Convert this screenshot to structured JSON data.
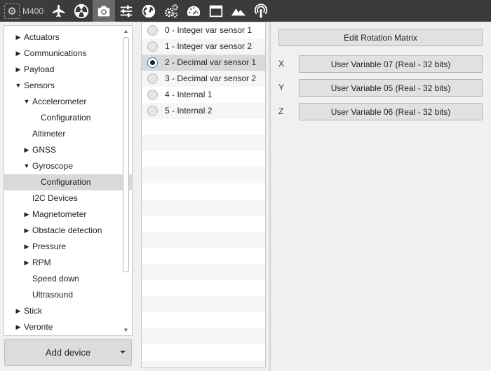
{
  "toolbar": {
    "device_label": "M400",
    "buttons": [
      {
        "icon": "airplane-icon",
        "active": false
      },
      {
        "icon": "radiation-icon",
        "active": false
      },
      {
        "icon": "camera-icon",
        "active": true
      },
      {
        "icon": "sliders-icon",
        "active": false
      },
      {
        "icon": "globe-icon",
        "active": false
      },
      {
        "icon": "gears-icon",
        "active": false
      },
      {
        "icon": "gauge-icon",
        "active": false
      },
      {
        "icon": "window-icon",
        "active": false
      },
      {
        "icon": "mountains-icon",
        "active": false
      },
      {
        "icon": "antenna-icon",
        "active": false
      }
    ]
  },
  "tree": [
    {
      "label": "Actuators",
      "level": 0,
      "arrow": "collapsed"
    },
    {
      "label": "Communications",
      "level": 0,
      "arrow": "collapsed"
    },
    {
      "label": "Payload",
      "level": 0,
      "arrow": "collapsed"
    },
    {
      "label": "Sensors",
      "level": 0,
      "arrow": "expanded"
    },
    {
      "label": "Accelerometer",
      "level": 1,
      "arrow": "expanded"
    },
    {
      "label": "Configuration",
      "level": 2,
      "arrow": "none"
    },
    {
      "label": "Altimeter",
      "level": 1,
      "arrow": "none"
    },
    {
      "label": "GNSS",
      "level": 1,
      "arrow": "collapsed"
    },
    {
      "label": "Gyroscope",
      "level": 1,
      "arrow": "expanded"
    },
    {
      "label": "Configuration",
      "level": 2,
      "arrow": "none",
      "selected": true
    },
    {
      "label": "I2C Devices",
      "level": 1,
      "arrow": "none"
    },
    {
      "label": "Magnetometer",
      "level": 1,
      "arrow": "collapsed"
    },
    {
      "label": "Obstacle detection",
      "level": 1,
      "arrow": "collapsed"
    },
    {
      "label": "Pressure",
      "level": 1,
      "arrow": "collapsed"
    },
    {
      "label": "RPM",
      "level": 1,
      "arrow": "collapsed"
    },
    {
      "label": "Speed down",
      "level": 1,
      "arrow": "none"
    },
    {
      "label": "Ultrasound",
      "level": 1,
      "arrow": "none"
    },
    {
      "label": "Stick",
      "level": 0,
      "arrow": "collapsed"
    },
    {
      "label": "Veronte",
      "level": 0,
      "arrow": "collapsed"
    }
  ],
  "add_device_label": "Add device",
  "sensors": [
    {
      "label": "0 - Integer var sensor 1",
      "checked": false
    },
    {
      "label": "1 - Integer var sensor 2",
      "checked": false
    },
    {
      "label": "2 - Decimal var sensor 1",
      "checked": true
    },
    {
      "label": "3 - Decimal var sensor 2",
      "checked": false
    },
    {
      "label": "4 - Internal 1",
      "checked": false
    },
    {
      "label": "5 - Internal 2",
      "checked": false
    }
  ],
  "config": {
    "edit_rotation_label": "Edit Rotation Matrix",
    "axes": [
      {
        "axis": "X",
        "value": "User Variable 07 (Real - 32 bits)"
      },
      {
        "axis": "Y",
        "value": "User Variable 05 (Real - 32 bits)"
      },
      {
        "axis": "Z",
        "value": "User Variable 06 (Real - 32 bits)"
      }
    ]
  },
  "colors": {
    "toolbar_bg": "#3b3b3b",
    "toolbar_active": "#6a6a6a",
    "selection": "#d9d9d9",
    "radio_focus": "#2a76c6"
  }
}
